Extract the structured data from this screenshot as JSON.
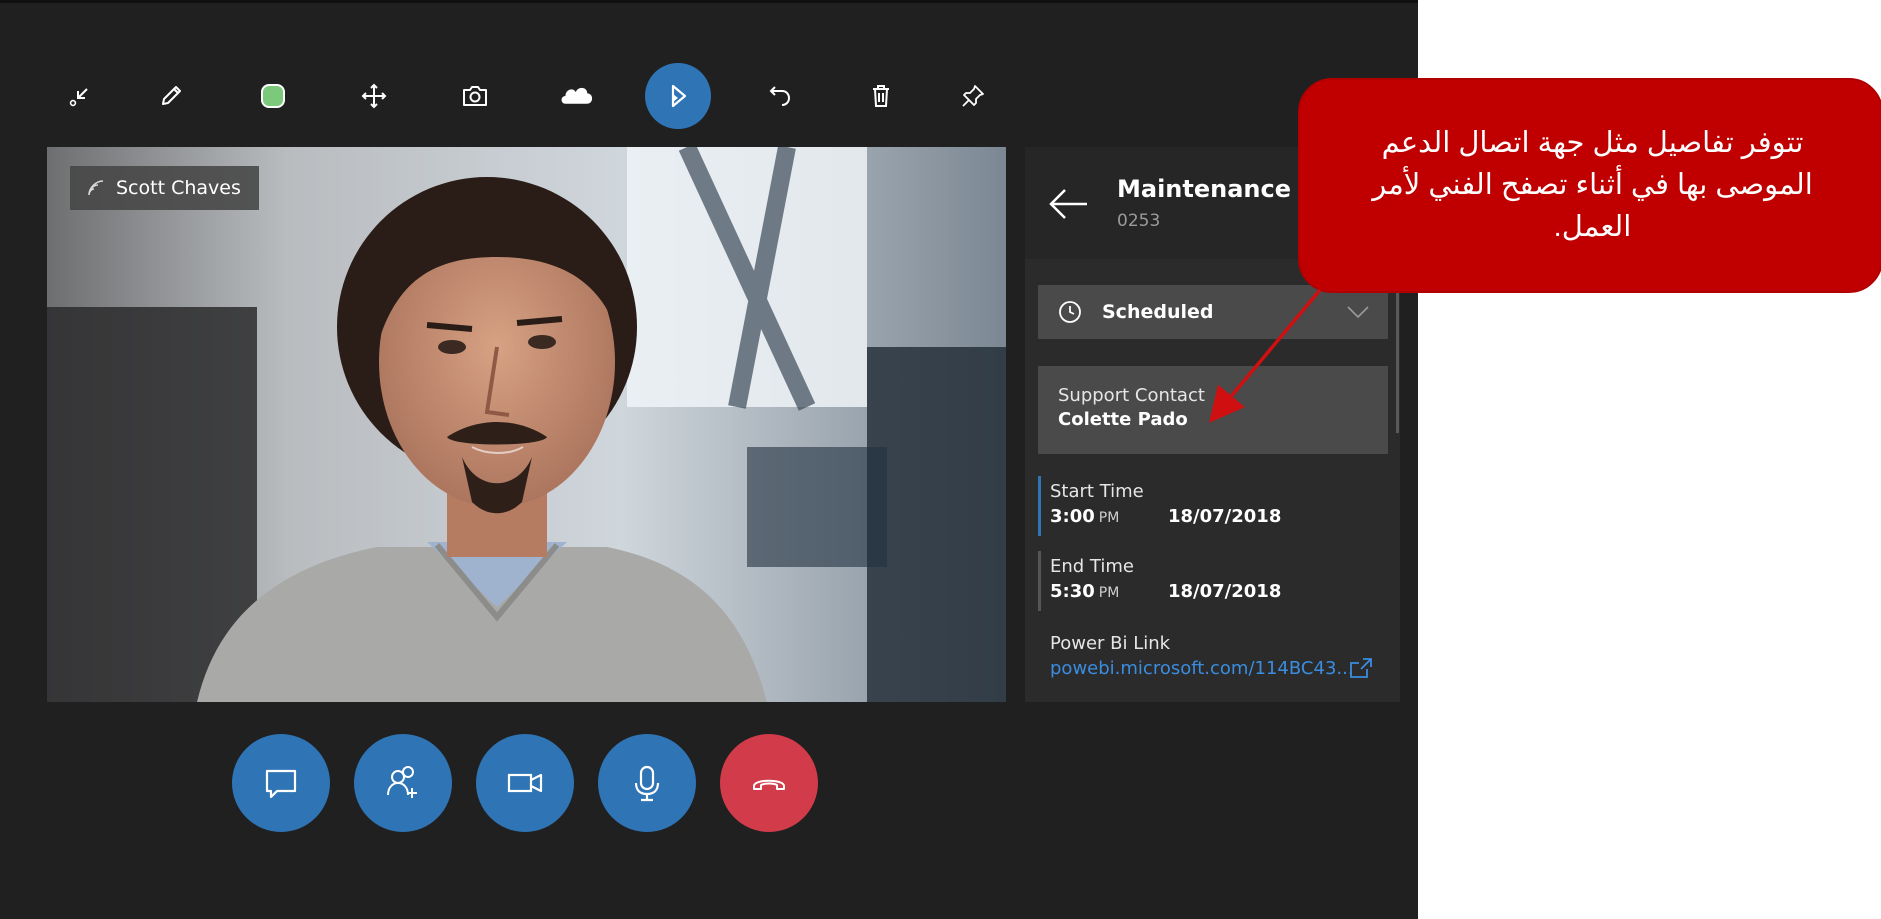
{
  "toolbar": {
    "tools": [
      {
        "icon": "minimize-icon"
      },
      {
        "icon": "pen-icon"
      },
      {
        "icon": "color-swatch-icon",
        "color": "#7cc97c"
      },
      {
        "icon": "move-icon"
      },
      {
        "icon": "camera-icon"
      },
      {
        "icon": "cloud-icon"
      },
      {
        "icon": "dynamics-logo-icon",
        "active": true
      },
      {
        "icon": "undo-icon"
      },
      {
        "icon": "trash-icon"
      },
      {
        "icon": "pin-icon"
      }
    ]
  },
  "video": {
    "participant_name": "Scott Chaves"
  },
  "panel": {
    "title": "Maintenance o",
    "subtitle": "0253",
    "status": "Scheduled",
    "support_contact": {
      "label": "Support Contact",
      "name": "Colette Pado"
    },
    "start_time": {
      "label": "Start Time",
      "time": "3:00",
      "ampm": "PM",
      "date": "18/07/2018"
    },
    "end_time": {
      "label": "End Time",
      "time": "5:30",
      "ampm": "PM",
      "date": "18/07/2018"
    },
    "power_bi": {
      "label": "Power Bi Link",
      "url": "powebi.microsoft.com/114BC43..."
    }
  },
  "call_controls": [
    {
      "icon": "chat-icon"
    },
    {
      "icon": "add-participant-icon"
    },
    {
      "icon": "video-camera-icon"
    },
    {
      "icon": "microphone-icon"
    },
    {
      "icon": "hang-up-icon",
      "color": "#d23b4a"
    }
  ],
  "callout": {
    "text": "تتوفر تفاصيل مثل جهة اتصال الدعم الموصى بها في أثناء تصفح الفني لأمر العمل."
  },
  "colors": {
    "accent": "#2f74b5",
    "hangup": "#d23b4a",
    "callout": "#c00000",
    "background": "#202020"
  }
}
